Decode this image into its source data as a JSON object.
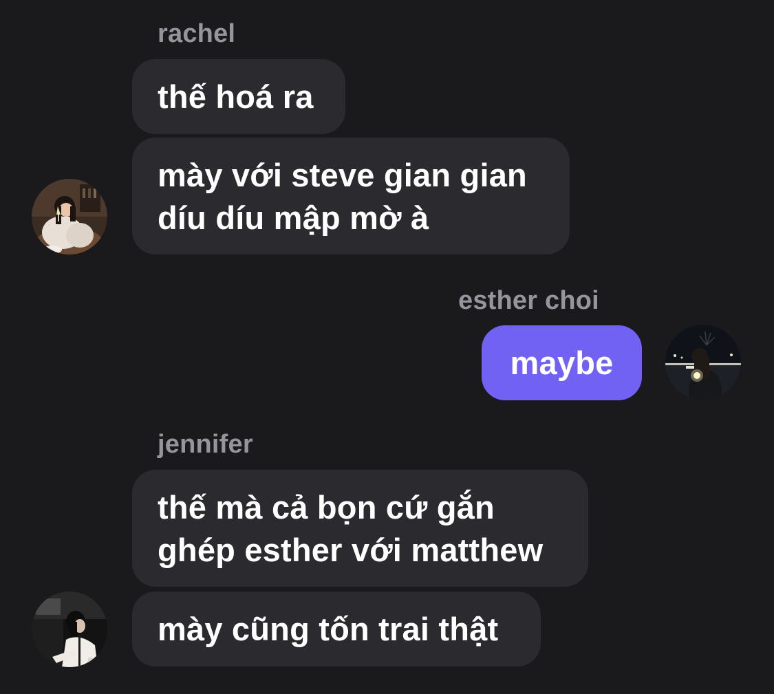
{
  "conversation": {
    "groups": [
      {
        "sender": "rachel",
        "avatar_icon": "user-photo-icon",
        "messages": [
          "thế hoá ra",
          "mày với steve gian gian\ndíu díu mập mờ à"
        ]
      },
      {
        "sender": "esther choi",
        "avatar_icon": "user-photo-icon",
        "messages": [
          "maybe"
        ]
      },
      {
        "sender": "jennifer",
        "avatar_icon": "user-photo-icon",
        "messages": [
          "thế mà cả bọn cứ gắn\nghép esther với matthew",
          "mày cũng tốn trai thật"
        ]
      }
    ]
  },
  "colors": {
    "background": "#1a1a1d",
    "incoming_bubble": "#2b2a2f",
    "outgoing_bubble": "#7262f3",
    "sender_name": "#96959c",
    "message_text": "#ffffff"
  }
}
